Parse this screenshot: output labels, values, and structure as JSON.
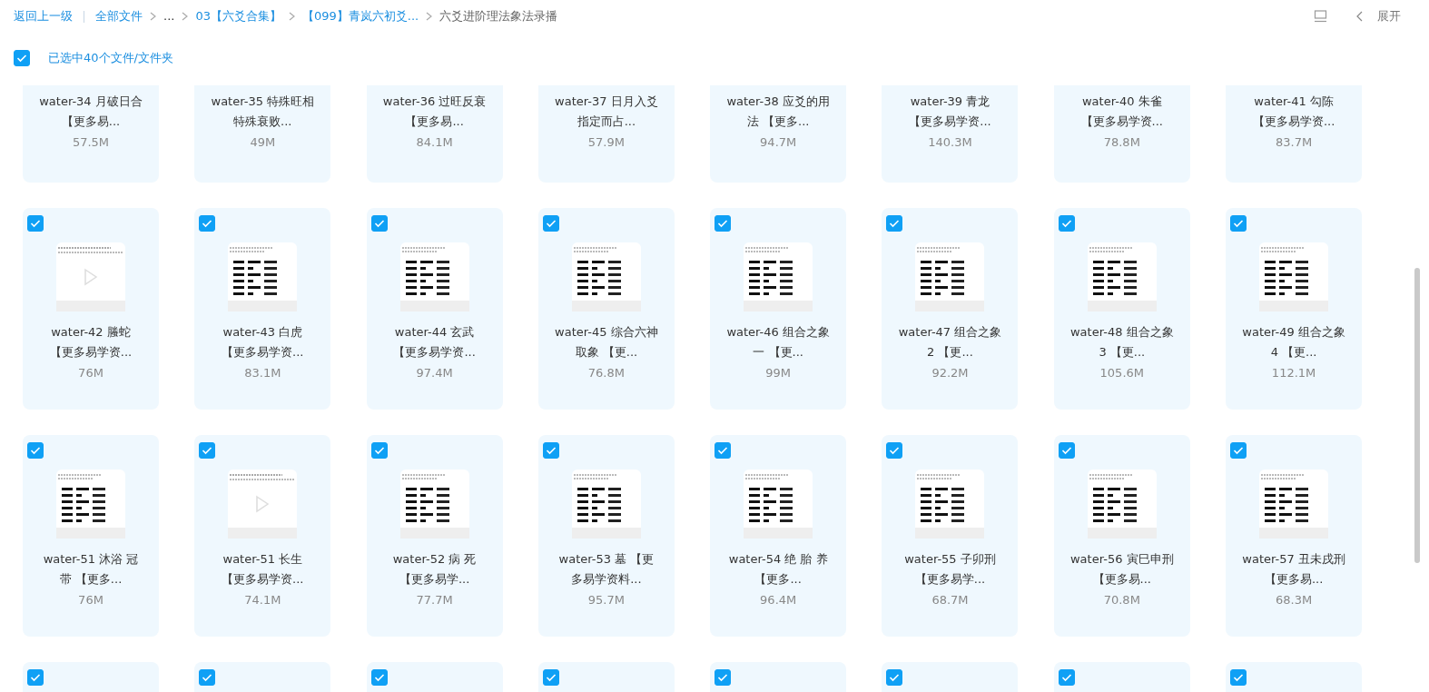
{
  "toolbar": {
    "back": "返回上一级",
    "breadcrumbs": [
      {
        "label": "全部文件",
        "kind": "link"
      },
      {
        "label": "...",
        "kind": "ellipsis"
      },
      {
        "label": "03【六爻合集】",
        "kind": "link"
      },
      {
        "label": "【099】青岚六初爻...",
        "kind": "link"
      },
      {
        "label": "六爻进阶理法象法录播",
        "kind": "current"
      }
    ],
    "expand": "展开"
  },
  "selection": {
    "checked": true,
    "label": "已选中40个文件/文件夹"
  },
  "files": [
    {
      "kind": "top-cut",
      "lines": [
        "water-34 月破日合",
        "【更多易..."
      ],
      "size": "57.5M"
    },
    {
      "kind": "top-cut",
      "lines": [
        "water-35 特殊旺相",
        "特殊衰败..."
      ],
      "size": "49M"
    },
    {
      "kind": "top-cut",
      "lines": [
        "water-36 过旺反衰",
        "【更多易..."
      ],
      "size": "84.1M"
    },
    {
      "kind": "top-cut",
      "lines": [
        "water-37 日月入爻",
        "指定而占..."
      ],
      "size": "57.9M"
    },
    {
      "kind": "top-cut",
      "lines": [
        "water-38 应爻的用",
        "法 【更多..."
      ],
      "size": "94.7M"
    },
    {
      "kind": "top-cut",
      "lines": [
        "water-39 青龙",
        "【更多易学资..."
      ],
      "size": "140.3M"
    },
    {
      "kind": "top-cut",
      "lines": [
        "water-40 朱雀",
        "【更多易学资..."
      ],
      "size": "78.8M"
    },
    {
      "kind": "top-cut",
      "lines": [
        "water-41 勾陈",
        "【更多易学资..."
      ],
      "size": "83.7M"
    },
    {
      "kind": "video",
      "checked": true,
      "lines": [
        "water-42 螣蛇",
        "【更多易学资..."
      ],
      "size": "76M"
    },
    {
      "kind": "doc",
      "checked": true,
      "lines": [
        "water-43 白虎",
        "【更多易学资..."
      ],
      "size": "83.1M"
    },
    {
      "kind": "doc",
      "checked": true,
      "lines": [
        "water-44 玄武",
        "【更多易学资..."
      ],
      "size": "97.4M"
    },
    {
      "kind": "doc",
      "checked": true,
      "lines": [
        "water-45 综合六神",
        "取象 【更..."
      ],
      "size": "76.8M"
    },
    {
      "kind": "doc",
      "checked": true,
      "lines": [
        "water-46 组合之象",
        "一 【更..."
      ],
      "size": "99M"
    },
    {
      "kind": "doc",
      "checked": true,
      "lines": [
        "water-47 组合之象",
        "2 【更..."
      ],
      "size": "92.2M"
    },
    {
      "kind": "doc",
      "checked": true,
      "lines": [
        "water-48 组合之象",
        "3 【更..."
      ],
      "size": "105.6M"
    },
    {
      "kind": "doc",
      "checked": true,
      "lines": [
        "water-49 组合之象",
        "4 【更..."
      ],
      "size": "112.1M"
    },
    {
      "kind": "doc",
      "checked": true,
      "lines": [
        "water-51 沐浴 冠",
        "带 【更多..."
      ],
      "size": "76M"
    },
    {
      "kind": "video",
      "checked": true,
      "lines": [
        "water-51 长生",
        "【更多易学资..."
      ],
      "size": "74.1M"
    },
    {
      "kind": "doc",
      "checked": true,
      "lines": [
        "water-52 病 死",
        "【更多易学..."
      ],
      "size": "77.7M"
    },
    {
      "kind": "doc",
      "checked": true,
      "lines": [
        "water-53 墓 【更",
        "多易学资料..."
      ],
      "size": "95.7M"
    },
    {
      "kind": "doc",
      "checked": true,
      "lines": [
        "water-54 绝 胎 养",
        "【更多..."
      ],
      "size": "96.4M"
    },
    {
      "kind": "doc",
      "checked": true,
      "lines": [
        "water-55 子卯刑",
        "【更多易学..."
      ],
      "size": "68.7M"
    },
    {
      "kind": "doc",
      "checked": true,
      "lines": [
        "water-56 寅巳申刑",
        "【更多易..."
      ],
      "size": "70.8M"
    },
    {
      "kind": "doc",
      "checked": true,
      "lines": [
        "water-57 丑未戌刑",
        "【更多易..."
      ],
      "size": "68.3M"
    },
    {
      "kind": "bottom-cut",
      "checked": true
    },
    {
      "kind": "bottom-cut",
      "checked": true
    },
    {
      "kind": "bottom-cut",
      "checked": true
    },
    {
      "kind": "bottom-cut",
      "checked": true
    },
    {
      "kind": "bottom-cut",
      "checked": true
    },
    {
      "kind": "bottom-cut",
      "checked": true
    },
    {
      "kind": "bottom-cut",
      "checked": true
    },
    {
      "kind": "bottom-cut",
      "checked": true
    }
  ]
}
